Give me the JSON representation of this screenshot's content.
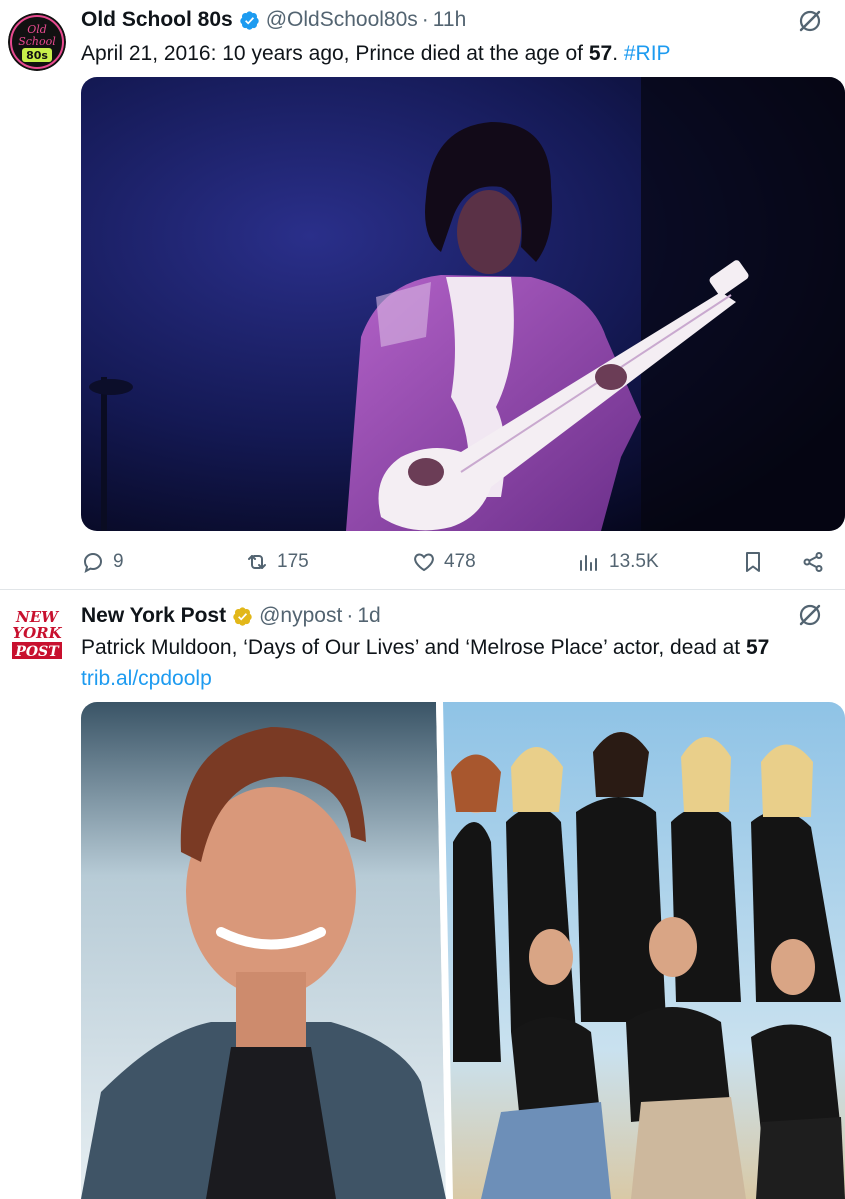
{
  "tweets": [
    {
      "author_name": "Old School 80s",
      "handle": "@OldSchool80s",
      "separator": "·",
      "time": "11h",
      "avatar_text": "Old School 80s",
      "text_parts": [
        "April 21, 2016: 10 years ago, Prince died at the age of ",
        "57",
        ". ",
        "#RIP"
      ],
      "media_alt": "Prince performing on stage in purple jacket with white guitar",
      "stats": {
        "replies": "9",
        "reposts": "175",
        "likes": "478",
        "views": "13.5K"
      }
    },
    {
      "author_name": "New York Post",
      "handle": "@nypost",
      "separator": "·",
      "time": "1d",
      "avatar_text": [
        "NEW",
        "YORK",
        "POST"
      ],
      "text_parts": [
        "Patrick Muldoon, ‘Days of Our Lives’ and ‘Melrose Place’ actor, dead at ",
        "57",
        " ",
        "trib.al/cpdoolp"
      ],
      "media_alt_left": "Patrick Muldoon smiling",
      "media_alt_right": "Melrose Place cast photo"
    }
  ],
  "colors": {
    "link": "#1d9bf0",
    "verified": "#1d9bf0",
    "gold_badge": "#e2b719",
    "muted": "#536471"
  },
  "icons": [
    "verified-badge-icon",
    "grok-icon",
    "reply-icon",
    "repost-icon",
    "like-icon",
    "views-icon",
    "bookmark-icon",
    "share-icon"
  ]
}
